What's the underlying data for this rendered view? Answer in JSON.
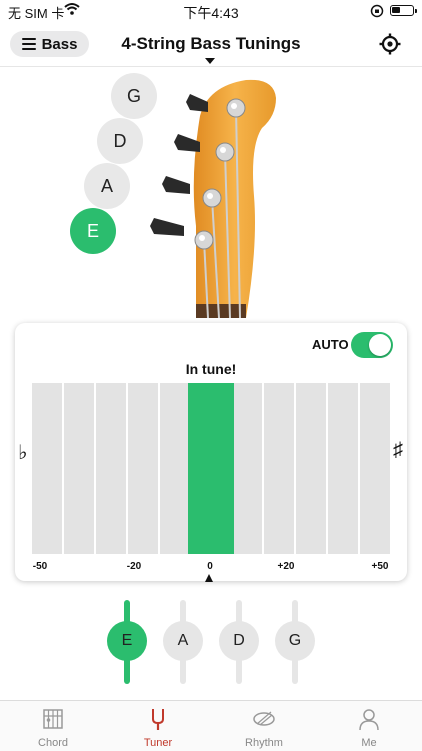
{
  "status_bar": {
    "carrier": "无 SIM 卡",
    "time": "下午4:43"
  },
  "header": {
    "bass_button_label": "Bass",
    "title": "4-String Bass Tunings"
  },
  "headstock_strings": [
    {
      "label": "G",
      "active": false
    },
    {
      "label": "D",
      "active": false
    },
    {
      "label": "A",
      "active": false
    },
    {
      "label": "E",
      "active": true
    }
  ],
  "tuner": {
    "auto_label": "AUTO",
    "auto_on": true,
    "status": "In tune!",
    "flat_symbol": "♭",
    "sharp_symbol": "♯",
    "scale_labels": [
      "-50",
      "-20",
      "0",
      "+20",
      "+50"
    ]
  },
  "string_selector": [
    {
      "label": "E",
      "active": true
    },
    {
      "label": "A",
      "active": false
    },
    {
      "label": "D",
      "active": false
    },
    {
      "label": "G",
      "active": false
    }
  ],
  "tabs": [
    {
      "label": "Chord",
      "icon": "chord-icon",
      "active": false
    },
    {
      "label": "Tuner",
      "icon": "tuning-fork-icon",
      "active": true
    },
    {
      "label": "Rhythm",
      "icon": "drum-icon",
      "active": false
    },
    {
      "label": "Me",
      "icon": "person-icon",
      "active": false
    }
  ],
  "colors": {
    "accent": "#2bbd6e",
    "active_tab": "#c0392b",
    "headstock": "#f0a93a"
  }
}
